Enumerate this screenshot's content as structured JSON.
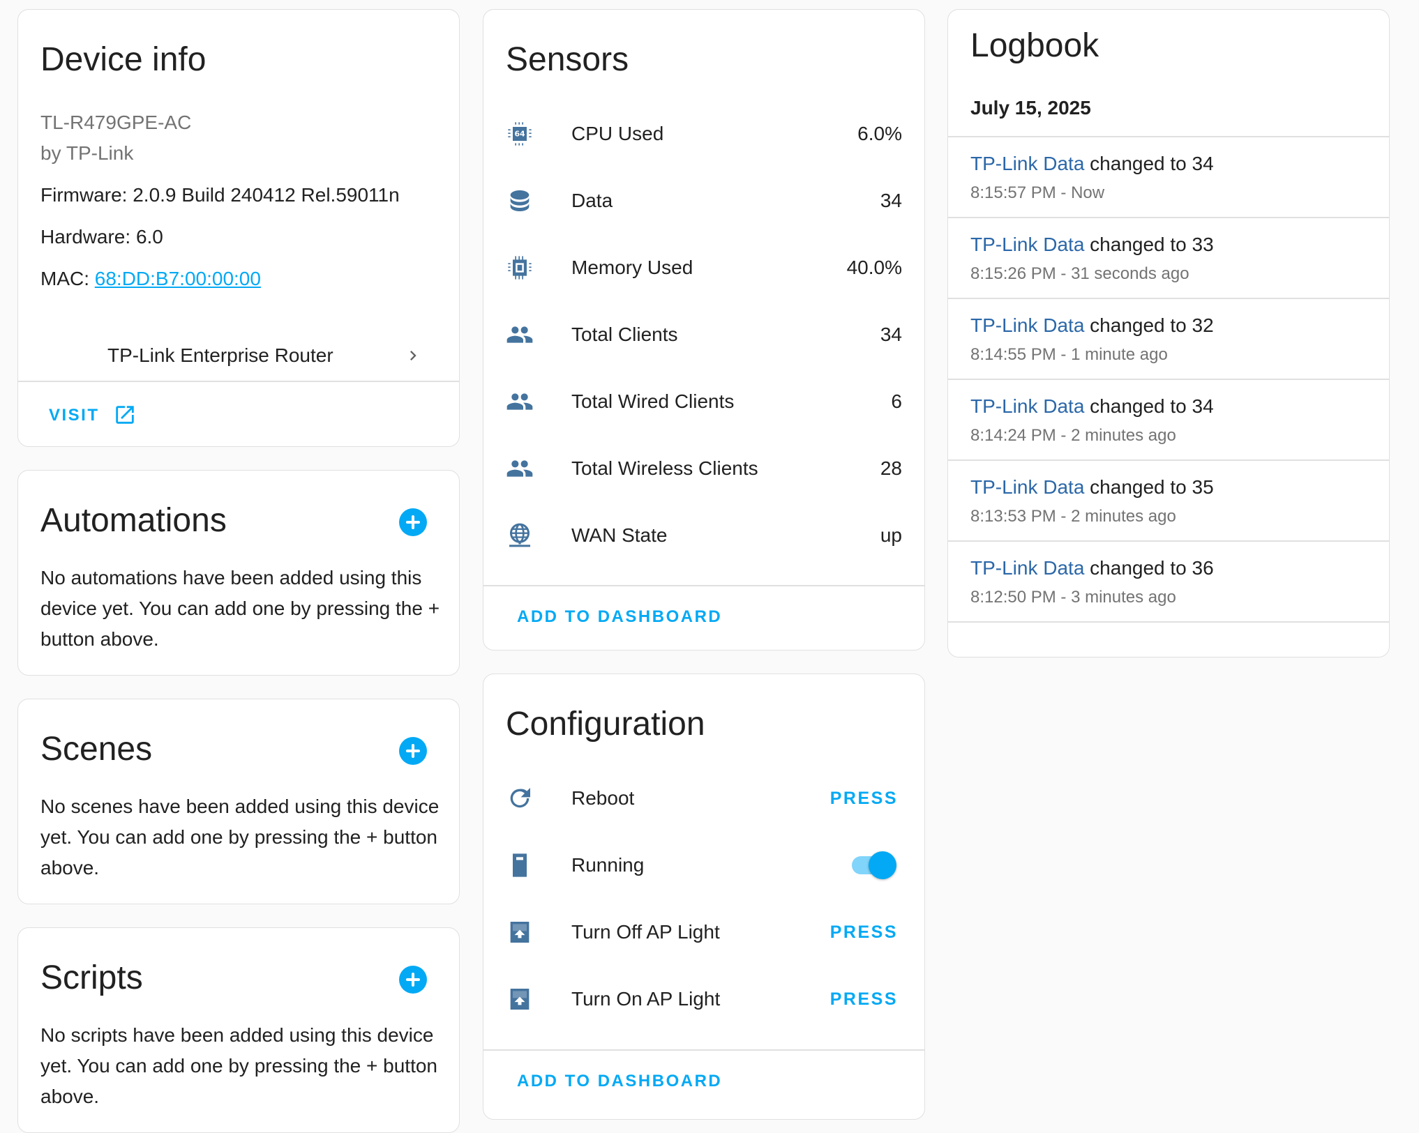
{
  "colors": {
    "accent": "#03a9f4",
    "icon": "#44739e",
    "link": "#2b67a8"
  },
  "device_info": {
    "title": "Device info",
    "model": "TL-R479GPE-AC",
    "manufacturer": "by TP-Link",
    "firmware": "Firmware: 2.0.9 Build 240412 Rel.59011n",
    "hardware": "Hardware: 6.0",
    "mac_label": "MAC: ",
    "mac_value": "68:DD:B7:00:00:00",
    "via_device": "TP-Link Enterprise Router",
    "visit_label": "VISIT"
  },
  "automations": {
    "title": "Automations",
    "text": "No automations have been added using this device yet. You can add one by pressing the + button above."
  },
  "scenes": {
    "title": "Scenes",
    "text": "No scenes have been added using this device yet. You can add one by pressing the + button above."
  },
  "scripts": {
    "title": "Scripts",
    "text": "No scripts have been added using this device yet. You can add one by pressing the + button above."
  },
  "sensors": {
    "title": "Sensors",
    "items": [
      {
        "icon": "cpu-64-icon",
        "label": "CPU Used",
        "value": "6.0%"
      },
      {
        "icon": "database-icon",
        "label": "Data",
        "value": "34"
      },
      {
        "icon": "chip-icon",
        "label": "Memory Used",
        "value": "40.0%"
      },
      {
        "icon": "account-group-icon",
        "label": "Total Clients",
        "value": "34"
      },
      {
        "icon": "account-group-icon",
        "label": "Total Wired Clients",
        "value": "6"
      },
      {
        "icon": "account-group-icon",
        "label": "Total Wireless Clients",
        "value": "28"
      },
      {
        "icon": "web-icon",
        "label": "WAN State",
        "value": "up"
      }
    ],
    "add_to_dashboard": "ADD TO DASHBOARD"
  },
  "configuration": {
    "title": "Configuration",
    "items": [
      {
        "icon": "restart-icon",
        "label": "Reboot",
        "action": "PRESS"
      },
      {
        "icon": "door-icon",
        "label": "Running",
        "toggle_on": true
      },
      {
        "icon": "inbox-arrow-up-icon",
        "label": "Turn Off AP Light",
        "action": "PRESS"
      },
      {
        "icon": "inbox-arrow-up-icon",
        "label": "Turn On AP Light",
        "action": "PRESS"
      }
    ],
    "add_to_dashboard": "ADD TO DASHBOARD"
  },
  "logbook": {
    "title": "Logbook",
    "date": "July 15, 2025",
    "entries": [
      {
        "entity": "TP-Link Data",
        "message": " changed to 34",
        "time": "8:15:57 PM - Now"
      },
      {
        "entity": "TP-Link Data",
        "message": " changed to 33",
        "time": "8:15:26 PM - 31 seconds ago"
      },
      {
        "entity": "TP-Link Data",
        "message": " changed to 32",
        "time": "8:14:55 PM - 1 minute ago"
      },
      {
        "entity": "TP-Link Data",
        "message": " changed to 34",
        "time": "8:14:24 PM - 2 minutes ago"
      },
      {
        "entity": "TP-Link Data",
        "message": " changed to 35",
        "time": "8:13:53 PM - 2 minutes ago"
      },
      {
        "entity": "TP-Link Data",
        "message": " changed to 36",
        "time": "8:12:50 PM - 3 minutes ago"
      }
    ]
  }
}
